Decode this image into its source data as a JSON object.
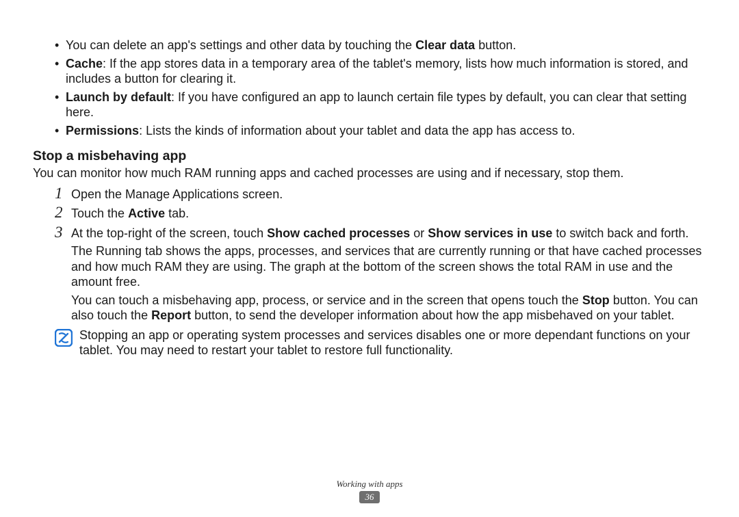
{
  "bullets": [
    {
      "pre": "You can delete an app's settings and other data by touching the ",
      "bold": "Clear data",
      "post": " button."
    },
    {
      "term": "Cache",
      "desc": ": If the app stores data in a temporary area of the tablet's memory, lists how much information is stored, and includes a button for clearing it."
    },
    {
      "term": "Launch by default",
      "desc": ": If you have configured an app to launch certain file types by default, you can clear that setting here."
    },
    {
      "term": "Permissions",
      "desc": ": Lists the kinds of information about your tablet and data the app has access to."
    }
  ],
  "heading": "Stop a misbehaving app",
  "intro": "You can monitor how much RAM running apps and cached processes are using and if necessary, stop them.",
  "steps": [
    {
      "num": "1",
      "text": "Open the Manage Applications screen."
    },
    {
      "num": "2",
      "pre": "Touch the ",
      "bold": "Active",
      "post": " tab."
    },
    {
      "num": "3",
      "p1_a": "At the top-right of the screen, touch ",
      "p1_b1": "Show cached processes",
      "p1_c": " or ",
      "p1_b2": "Show services in use",
      "p1_d": " to switch back and forth.",
      "p2": "The Running tab shows the apps, processes, and services that are currently running or that have cached processes and how much RAM they are using. The graph at the bottom of the screen shows the total RAM in use and the amount free.",
      "p3_a": "You can touch a misbehaving app, process, or service and in the screen that opens touch the ",
      "p3_b1": "Stop",
      "p3_c": " button. You can also touch the ",
      "p3_b2": "Report",
      "p3_d": " button, to send the developer information about how the app misbehaved on your tablet."
    }
  ],
  "note": "Stopping an app or operating system processes and services disables one or more dependant functions on your tablet. You may need to restart your tablet to restore full functionality.",
  "footer": {
    "section": "Working with apps",
    "page": "36"
  },
  "colors": {
    "icon_blue": "#1f74d6",
    "badge_gray": "#6f6f6f"
  }
}
